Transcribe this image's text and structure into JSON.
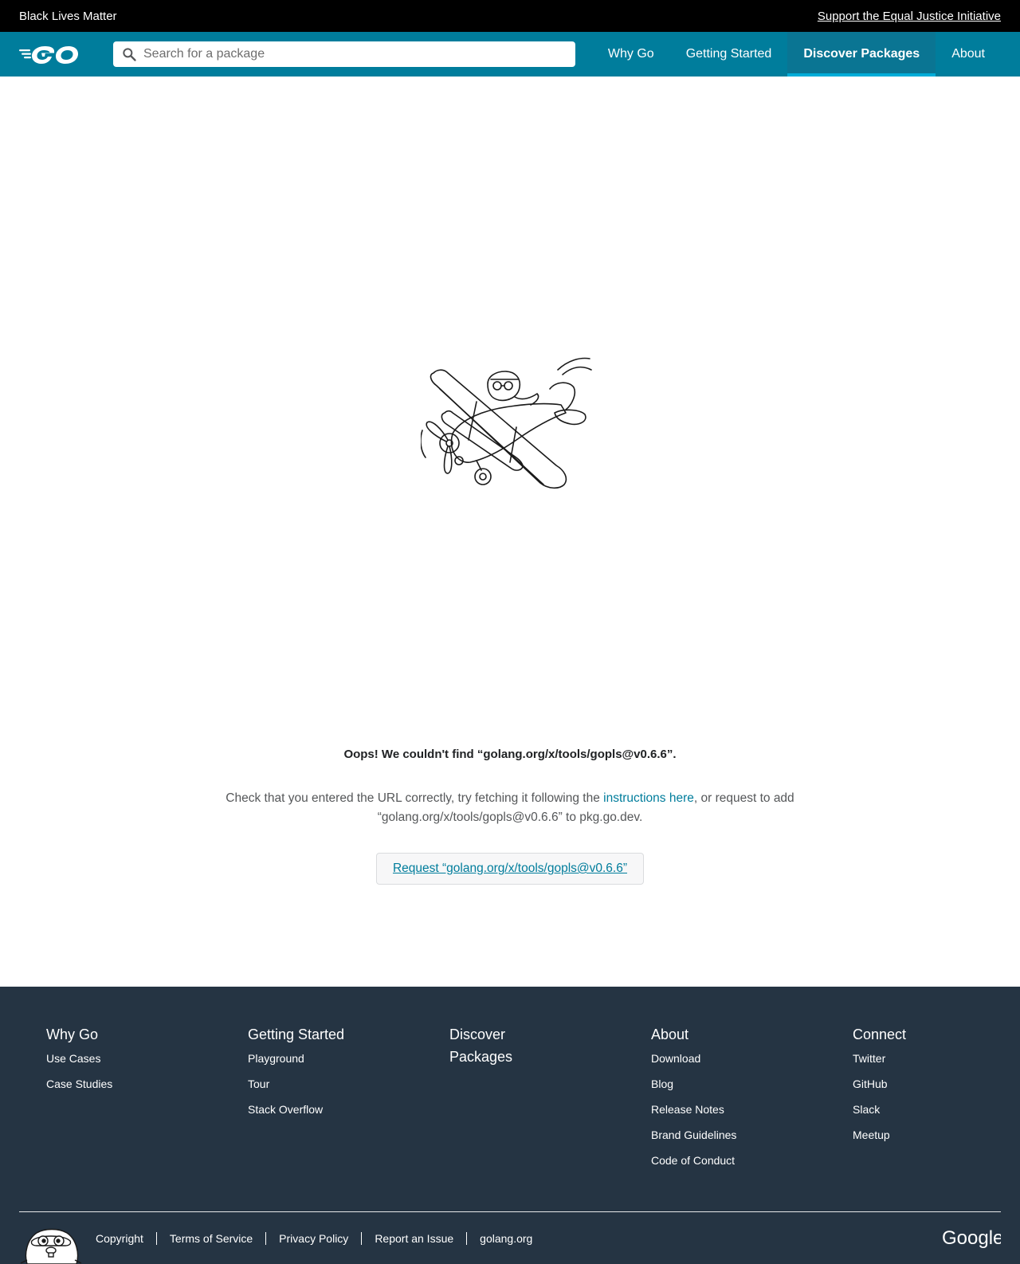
{
  "banner": {
    "title": "Black Lives Matter",
    "link": "Support the Equal Justice Initiative"
  },
  "header": {
    "logo_icon": "go-logo-icon",
    "search": {
      "placeholder": "Search for a package",
      "value": ""
    },
    "nav": [
      {
        "label": "Why Go",
        "active": false
      },
      {
        "label": "Getting Started",
        "active": false
      },
      {
        "label": "Discover Packages",
        "active": true
      },
      {
        "label": "About",
        "active": false
      }
    ]
  },
  "main": {
    "illustration": "gopher-biplane-icon",
    "heading": "Oops! We couldn't find “golang.org/x/tools/gopls@v0.6.6”.",
    "message_before": "Check that you entered the URL correctly, try fetching it following the ",
    "message_link": "instructions here",
    "message_after": ", or request to add “golang.org/x/tools/gopls@v0.6.6” to pkg.go.dev.",
    "request_button": "Request “golang.org/x/tools/gopls@v0.6.6”"
  },
  "footer": {
    "columns": [
      {
        "title": "Why Go",
        "links": [
          "Use Cases",
          "Case Studies"
        ]
      },
      {
        "title": "Getting Started",
        "links": [
          "Playground",
          "Tour",
          "Stack Overflow"
        ]
      },
      {
        "title": "Discover Packages",
        "links": []
      },
      {
        "title": "About",
        "links": [
          "Download",
          "Blog",
          "Release Notes",
          "Brand Guidelines",
          "Code of Conduct"
        ]
      },
      {
        "title": "Connect",
        "links": [
          "Twitter",
          "GitHub",
          "Slack",
          "Meetup"
        ]
      }
    ],
    "bottom_links": [
      "Copyright",
      "Terms of Service",
      "Privacy Policy",
      "Report an Issue",
      "golang.org"
    ],
    "google_logo": "Google"
  },
  "colors": {
    "banner": "#000000",
    "header": "#007d9c",
    "active_underline": "#00add8",
    "link": "#007d9c",
    "footer": "#253443"
  }
}
